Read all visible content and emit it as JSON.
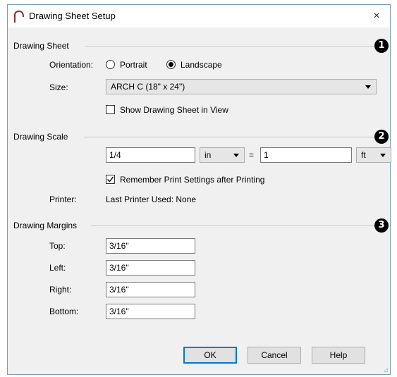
{
  "window": {
    "title": "Drawing Sheet Setup",
    "close_glyph": "×"
  },
  "drawing_sheet": {
    "group_label": "Drawing Sheet",
    "badge": "1",
    "orientation_label": "Orientation:",
    "portrait_label": "Portrait",
    "landscape_label": "Landscape",
    "selected_orientation": "Landscape",
    "size_label": "Size:",
    "size_value": "ARCH C  (18\" x 24\")",
    "show_in_view_label": "Show Drawing Sheet in View",
    "show_in_view_checked": false
  },
  "drawing_scale": {
    "group_label": "Drawing Scale",
    "badge": "2",
    "left_value": "1/4",
    "left_unit": "in",
    "equals": "=",
    "right_value": "1",
    "right_unit": "ft",
    "remember_label": "Remember Print Settings after Printing",
    "remember_checked": true,
    "printer_label": "Printer:",
    "printer_value": "Last Printer Used: None"
  },
  "drawing_margins": {
    "group_label": "Drawing Margins",
    "badge": "3",
    "top_label": "Top:",
    "top_value": "3/16\"",
    "left_label": "Left:",
    "left_value": "3/16\"",
    "right_label": "Right:",
    "right_value": "3/16\"",
    "bottom_label": "Bottom:",
    "bottom_value": "3/16\""
  },
  "buttons": {
    "ok": "OK",
    "cancel": "Cancel",
    "help": "Help"
  },
  "colors": {
    "accent": "#0078d7",
    "dialog_bg": "#f0f0f0",
    "border": "#7a9cc0"
  },
  "icons": {
    "app": "arch-icon",
    "close": "close-icon",
    "grip": "resize-grip-icon"
  }
}
